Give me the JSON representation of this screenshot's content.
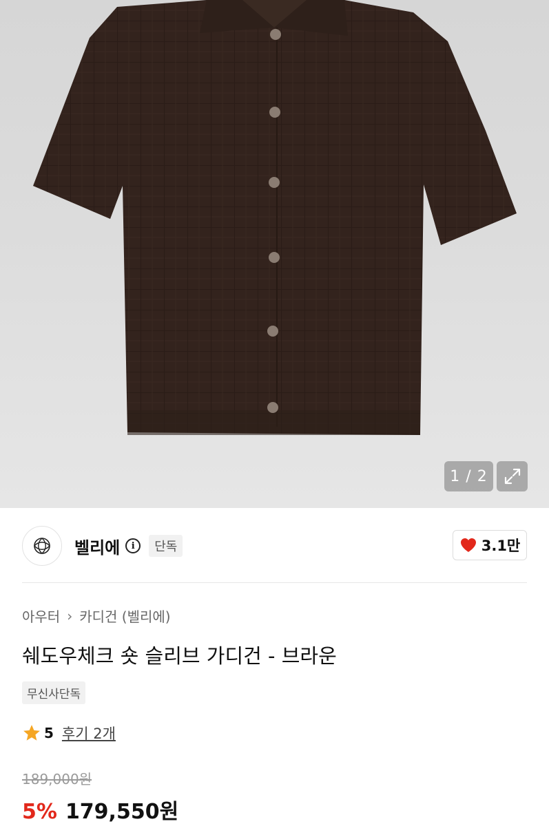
{
  "gallery": {
    "pager": "1 / 2",
    "expand_icon": "expand-icon"
  },
  "brand": {
    "name": "벨리에",
    "info_icon": "info-icon",
    "exclusive_badge": "단독",
    "like_count": "3.1만",
    "like_color": "#e2281b"
  },
  "breadcrumb": {
    "category": "아우터",
    "subcategory": "카디건 (벨리에)"
  },
  "product": {
    "title": "쉐도우체크 숏 슬리브 가디건 - 브라운",
    "tag": "무신사단독",
    "rating": "5",
    "reviews": "후기 2개",
    "original_price": "189,000원",
    "discount": "5%",
    "price": "179,550원"
  },
  "colors": {
    "accent_red": "#e2281b",
    "star": "#f5a623",
    "garment": "#33231d"
  }
}
